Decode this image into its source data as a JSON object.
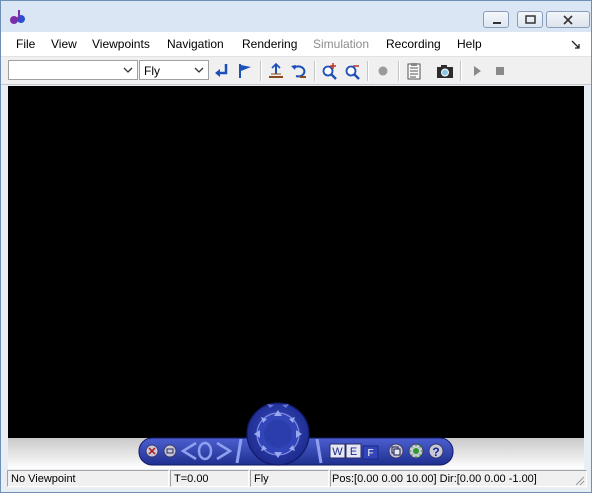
{
  "menu": {
    "file": "File",
    "view": "View",
    "viewpoints": "Viewpoints",
    "navigation": "Navigation",
    "rendering": "Rendering",
    "simulation": "Simulation",
    "recording": "Recording",
    "help": "Help"
  },
  "toolbar": {
    "viewpoint_select": "",
    "nav_mode_select": "Fly",
    "icons": [
      "return-icon",
      "flag-icon",
      "straighten-up-icon",
      "undo-move-icon",
      "zoom-in-icon",
      "zoom-out-icon",
      "record-icon",
      "notes-icon",
      "camera-icon",
      "play-icon",
      "stop-icon"
    ]
  },
  "navpanel": {
    "buttons": [
      "close-icon",
      "minimize-icon",
      "left-arrow-icon",
      "right-arrow-icon",
      "fly-wheel-icon",
      "w-button",
      "e-button",
      "f-button",
      "copy-icon",
      "headlight-icon",
      "help-icon"
    ],
    "w_label": "W",
    "e_label": "E",
    "f_label": "F",
    "help_label": "?"
  },
  "status": {
    "viewpoint": "No Viewpoint",
    "time": "T=0.00",
    "mode": "Fly",
    "position": "Pos:[0.00 0.00 10.00] Dir:[0.00 0.00 -1.00]"
  },
  "colors": {
    "panel_blue": "#283aa8",
    "panel_light": "#5c6fd6",
    "viewport": "#000000",
    "accent_blue": "#1d4fb8"
  }
}
